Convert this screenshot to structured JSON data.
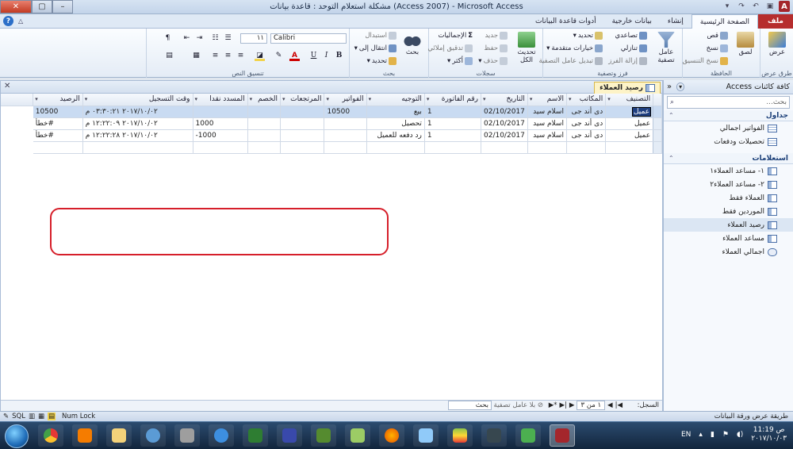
{
  "window": {
    "title": "مشكلة استعلام التوحد : قاعدة بيانات (Access 2007) - Microsoft Access",
    "app_letter": "A"
  },
  "ribbon_tabs": [
    "ملف",
    "الصفحة الرئيسية",
    "إنشاء",
    "بيانات خارجية",
    "أدوات قاعدة البيانات"
  ],
  "ribbon": {
    "views": {
      "label": "عرض",
      "group": "طرق عرض"
    },
    "clipboard": {
      "paste": "لصق",
      "cut": "قص",
      "copy": "نسخ",
      "format_painter": "نسخ التنسيق",
      "group": "الحافظة"
    },
    "sort_filter": {
      "filter": "عامل تصفية",
      "ascending": "تصاعدي",
      "descending": "تنازلي",
      "remove_sort": "إزالة الفرز",
      "selection": "تحديد",
      "advanced": "خيارات متقدمة",
      "toggle_filter": "تبديل عامل التصفية",
      "group": "فرز وتصفية"
    },
    "records": {
      "refresh": "تحديث الكل",
      "new": "جديد",
      "save": "حفظ",
      "delete": "حذف",
      "totals": "الإجماليات",
      "spelling": "تدقيق إملائي",
      "more": "أكثر",
      "group": "سجلات"
    },
    "find": {
      "find": "بحث",
      "replace": "استبدال",
      "goto": "انتقال إلى",
      "select": "تحديد",
      "group": "بحث"
    },
    "text_format": {
      "font": "Calibri",
      "size": "١١",
      "bold": "B",
      "italic": "I",
      "underline": "U",
      "group": "تنسيق النص"
    }
  },
  "nav_pane": {
    "title": "كافة كائنات Access",
    "search_placeholder": "بحث...",
    "sections": [
      {
        "title": "جداول",
        "items": [
          {
            "label": "الفواتير اجمالي",
            "icon": "table-icon"
          },
          {
            "label": "تحصيلات ودفعات",
            "icon": "table-icon"
          }
        ]
      },
      {
        "title": "استعلامات",
        "items": [
          {
            "label": "١- مساعد العملاء١",
            "icon": "query-icon"
          },
          {
            "label": "٢- مساعد العملاء٢",
            "icon": "query-icon"
          },
          {
            "label": "العملاء فقط",
            "icon": "query-icon"
          },
          {
            "label": "الموردين فقط",
            "icon": "query-icon"
          },
          {
            "label": "رصيد العملاء",
            "icon": "query-icon",
            "selected": true
          },
          {
            "label": "مساعد العملاء",
            "icon": "query-icon"
          },
          {
            "label": "اجمالي العملاء",
            "icon": "union-query-icon"
          }
        ]
      }
    ]
  },
  "document": {
    "tab_title": "رصيد العملاء",
    "columns": [
      "التصنيف",
      "المكاتب",
      "الاسم",
      "التاريخ",
      "رقم الفاتورة",
      "التوجيه",
      "الفواتير",
      "المرتجعات",
      "الخصم",
      "المسدد نقدا",
      "وقت التسجيل",
      "الرصيد"
    ],
    "rows": [
      [
        "عميل",
        "دى أند جى",
        "اسلام سيد",
        "02/10/2017",
        "1",
        "بيع",
        "10500",
        "",
        "",
        "",
        "٢٠١٧/١٠/٠٢ ٠٣:٣٠:٢١ م",
        "10500"
      ],
      [
        "عميل",
        "دى أند جى",
        "اسلام سيد",
        "02/10/2017",
        "1",
        "تحصيل",
        "",
        "",
        "",
        "1000",
        "٢٠١٧/١٠/٠٢ ١٢:٢٢:٠٩ م",
        "#خطأ"
      ],
      [
        "عميل",
        "دى أند جى",
        "اسلام سيد",
        "02/10/2017",
        "1",
        "رد دفعه للعميل",
        "",
        "",
        "",
        "-1000",
        "٢٠١٧/١٠/٠٢ ١٢:٢٢:٢٨ م",
        "#خطأ"
      ]
    ]
  },
  "record_nav": {
    "label": "السجل:",
    "counter": "١ من ٣",
    "filter_status": "بلا عامل تصفية",
    "search": "بحث"
  },
  "statusbar": {
    "view_name": "طريقة عرض ورقة البيانات",
    "num_lock": "Num Lock"
  },
  "taskbar": {
    "language": "EN",
    "time": "11:19 ص",
    "date": "٢٠١٧/١٠/٠٣"
  },
  "colors": {
    "file_tab": "#b62d2d",
    "annotation_red": "#d61f2a",
    "selected_row": "#c9dbf2",
    "doc_tab": "#fdf3c7"
  }
}
